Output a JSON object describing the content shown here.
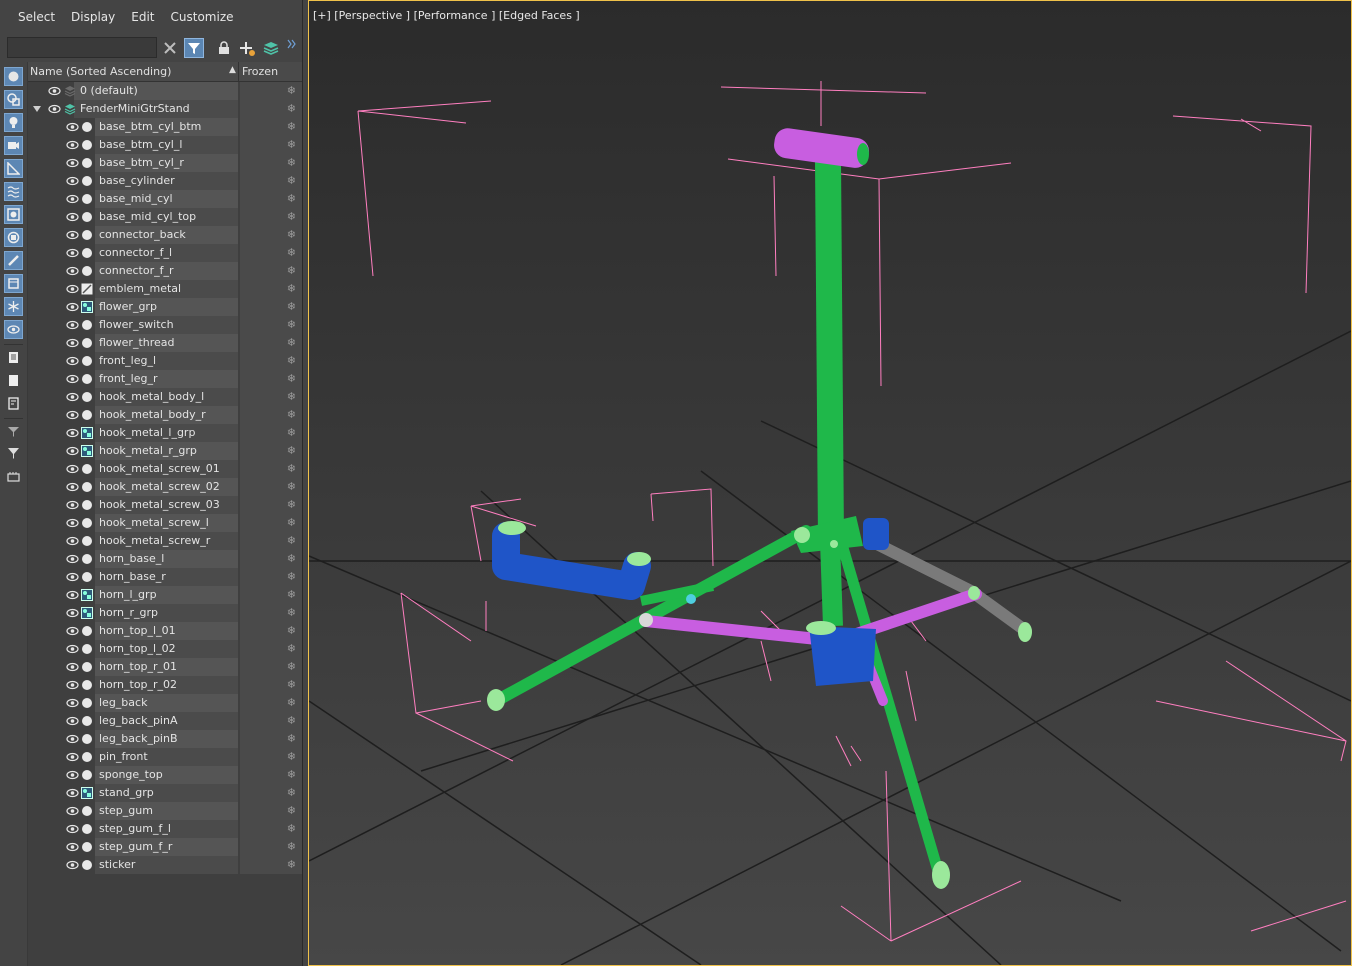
{
  "menu": [
    "Select",
    "Display",
    "Edit",
    "Customize"
  ],
  "search": {
    "value": ""
  },
  "toolbar_icons": [
    "clear-search-icon",
    "filter-icon",
    "lock-icon",
    "add-icon",
    "layers-icon",
    "expand-chevron-icon"
  ],
  "columns": {
    "name": "Name (Sorted Ascending)",
    "frozen": "Frozen"
  },
  "layers": {
    "default": "0 (default)",
    "main": "FenderMiniGtrStand"
  },
  "objects": [
    {
      "name": "base_btm_cyl_btm",
      "type": "mesh"
    },
    {
      "name": "base_btm_cyl_l",
      "type": "mesh"
    },
    {
      "name": "base_btm_cyl_r",
      "type": "mesh"
    },
    {
      "name": "base_cylinder",
      "type": "mesh"
    },
    {
      "name": "base_mid_cyl",
      "type": "mesh"
    },
    {
      "name": "base_mid_cyl_top",
      "type": "mesh"
    },
    {
      "name": "connector_back",
      "type": "mesh"
    },
    {
      "name": "connector_f_l",
      "type": "mesh"
    },
    {
      "name": "connector_f_r",
      "type": "mesh"
    },
    {
      "name": "emblem_metal",
      "type": "shape"
    },
    {
      "name": "flower_grp",
      "type": "group"
    },
    {
      "name": "flower_switch",
      "type": "mesh"
    },
    {
      "name": "flower_thread",
      "type": "mesh"
    },
    {
      "name": "front_leg_l",
      "type": "mesh"
    },
    {
      "name": "front_leg_r",
      "type": "mesh"
    },
    {
      "name": "hook_metal_body_l",
      "type": "mesh"
    },
    {
      "name": "hook_metal_body_r",
      "type": "mesh"
    },
    {
      "name": "hook_metal_l_grp",
      "type": "group"
    },
    {
      "name": "hook_metal_r_grp",
      "type": "group"
    },
    {
      "name": "hook_metal_screw_01",
      "type": "mesh"
    },
    {
      "name": "hook_metal_screw_02",
      "type": "mesh"
    },
    {
      "name": "hook_metal_screw_03",
      "type": "mesh"
    },
    {
      "name": "hook_metal_screw_l",
      "type": "mesh"
    },
    {
      "name": "hook_metal_screw_r",
      "type": "mesh"
    },
    {
      "name": "horn_base_l",
      "type": "mesh"
    },
    {
      "name": "horn_base_r",
      "type": "mesh"
    },
    {
      "name": "horn_l_grp",
      "type": "group"
    },
    {
      "name": "horn_r_grp",
      "type": "group"
    },
    {
      "name": "horn_top_l_01",
      "type": "mesh"
    },
    {
      "name": "horn_top_l_02",
      "type": "mesh"
    },
    {
      "name": "horn_top_r_01",
      "type": "mesh"
    },
    {
      "name": "horn_top_r_02",
      "type": "mesh"
    },
    {
      "name": "leg_back",
      "type": "mesh"
    },
    {
      "name": "leg_back_pinA",
      "type": "mesh"
    },
    {
      "name": "leg_back_pinB",
      "type": "mesh"
    },
    {
      "name": "pin_front",
      "type": "mesh"
    },
    {
      "name": "sponge_top",
      "type": "mesh"
    },
    {
      "name": "stand_grp",
      "type": "group"
    },
    {
      "name": "step_gum",
      "type": "mesh"
    },
    {
      "name": "step_gum_f_l",
      "type": "mesh"
    },
    {
      "name": "step_gum_f_r",
      "type": "mesh"
    },
    {
      "name": "sticker",
      "type": "mesh"
    }
  ],
  "viewport": {
    "label": "[+] [Perspective ] [Performance ] [Edged Faces ]",
    "colors": {
      "green": "#1fb84a",
      "magenta": "#c85ee0",
      "blue": "#1f55c8",
      "gray": "#7a7a7a",
      "light_green": "#9be89b",
      "bbox_pink": "#ff7fc0",
      "active_border": "#f0c24a"
    }
  }
}
